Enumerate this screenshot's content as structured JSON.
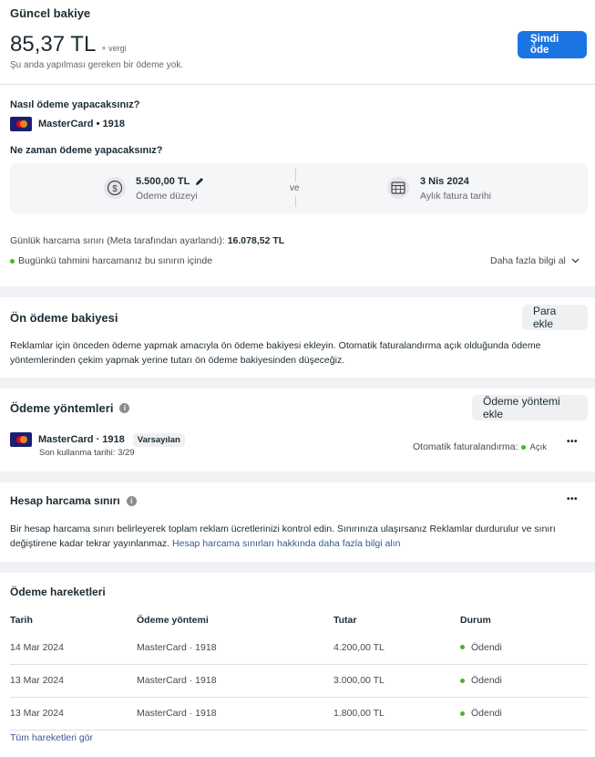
{
  "balance": {
    "heading": "Güncel bakiye",
    "amount": "85,37 TL",
    "tax_note": "+ vergi",
    "subtext": "Şu anda yapılması gereken bir ödeme yok.",
    "pay_button": "Şimdi öde"
  },
  "payment": {
    "how_label": "Nasıl ödeme yapacaksınız?",
    "card_label": "MasterCard • 1918",
    "when_label": "Ne zaman ödeme yapacaksınız?",
    "threshold_amount": "5.500,00 TL",
    "threshold_label": "Ödeme düzeyi",
    "and_text": "ve",
    "bill_date": "3 Nis 2024",
    "bill_date_label": "Aylık fatura tarihi",
    "daily_limit_prefix": "Günlük harcama sınırı (Meta tarafından ayarlandı):",
    "daily_limit_value": "16.078,52 TL",
    "within_limit_text": "Bugünkü tahmini harcamanız bu sınırın içinde",
    "more_info": "Daha fazla bilgi al"
  },
  "prepaid": {
    "title": "Ön ödeme bakiyesi",
    "add_button": "Para ekle",
    "description": "Reklamlar için önceden ödeme yapmak amacıyla ön ödeme bakiyesi ekleyin. Otomatik faturalandırma açık olduğunda ödeme yöntemlerinden çekim yapmak yerine tutarı ön ödeme bakiyesinden düşeceğiz."
  },
  "methods": {
    "title": "Ödeme yöntemleri",
    "add_button": "Ödeme yöntemi ekle",
    "card_label": "MasterCard · 1918",
    "default_badge": "Varsayılan",
    "last_used": "Son kullanma tarihi: 3/29",
    "auto_billing_label": "Otomatik faturalandırma:",
    "auto_billing_status": "Açık",
    "more": "•••"
  },
  "spend_limit": {
    "title": "Hesap harcama sınırı",
    "more": "•••",
    "description": "Bir hesap harcama sınırı belirleyerek toplam reklam ücretlerinizi kontrol edin. Sınırınıza ulaşırsanız Reklamlar durdurulur ve sınırı değiştirene kadar tekrar yayınlanmaz.",
    "link": "Hesap harcama sınırları hakkında daha fazla bilgi alın"
  },
  "transactions": {
    "title": "Ödeme hareketleri",
    "headers": [
      "Tarih",
      "Ödeme yöntemi",
      "Tutar",
      "Durum"
    ],
    "rows": [
      [
        "14 Mar 2024",
        "MasterCard · 1918",
        "4.200,00 TL",
        "Ödendi"
      ],
      [
        "13 Mar 2024",
        "MasterCard · 1918",
        "3.000,00 TL",
        "Ödendi"
      ],
      [
        "13 Mar 2024",
        "MasterCard · 1918",
        "1.800,00 TL",
        "Ödendi"
      ]
    ],
    "see_all": "Tüm hareketleri gör"
  },
  "colors": {
    "primary": "#1b74e4",
    "success": "#42b72a",
    "link": "#385898"
  }
}
